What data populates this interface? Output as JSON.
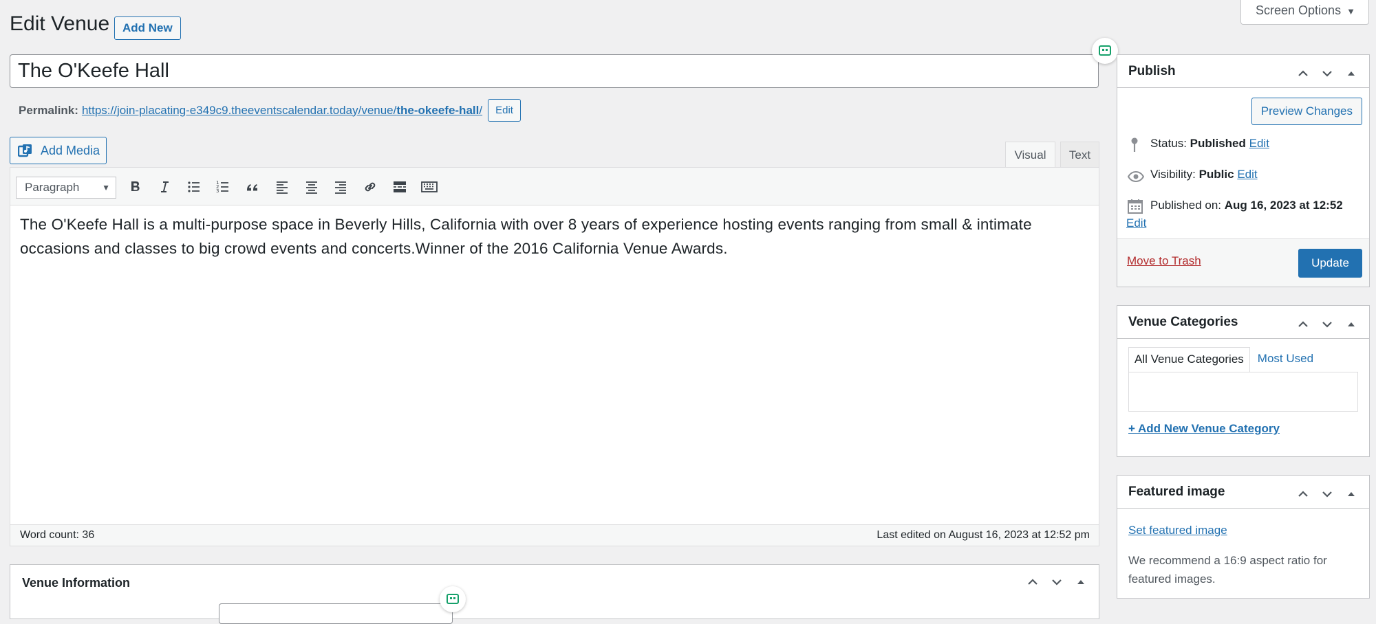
{
  "header": {
    "title": "Edit Venue",
    "add_new_label": "Add New",
    "screen_options_label": "Screen Options"
  },
  "post": {
    "title": "The O'Keefe Hall",
    "permalink_label": "Permalink:",
    "permalink_base": "https://join-placating-e349c9.theeventscalendar.today/venue/",
    "permalink_slug": "the-okeefe-hall",
    "permalink_trailing": "/",
    "permalink_edit_label": "Edit"
  },
  "editor": {
    "add_media_label": "Add Media",
    "tabs": {
      "visual": "Visual",
      "text": "Text"
    },
    "format_select_value": "Paragraph",
    "content": "The O'Keefe Hall is a multi-purpose space in Beverly Hills, California with over 8 years of experience hosting events ranging from small & intimate occasions and classes to big crowd events and concerts.Winner of the 2016 California Venue Awards.",
    "word_count": "Word count: 36",
    "last_edited": "Last edited on August 16, 2023 at 12:52 pm",
    "toolbar_icons": [
      "bold-icon",
      "italic-icon",
      "bullet-list-icon",
      "numbered-list-icon",
      "blockquote-icon",
      "align-left-icon",
      "align-center-icon",
      "align-right-icon",
      "link-icon",
      "read-more-icon",
      "toolbar-toggle-icon"
    ]
  },
  "venue_info": {
    "title": "Venue Information"
  },
  "publish": {
    "title": "Publish",
    "preview_label": "Preview Changes",
    "status_label": "Status:",
    "status_value": "Published",
    "visibility_label": "Visibility:",
    "visibility_value": "Public",
    "published_on_label": "Published on:",
    "published_on_value": "Aug 16, 2023 at 12:52",
    "edit_label": "Edit",
    "trash_label": "Move to Trash",
    "update_label": "Update"
  },
  "categories": {
    "title": "Venue Categories",
    "tab_all": "All Venue Categories",
    "tab_used": "Most Used",
    "add_new_label": "+ Add New Venue Category"
  },
  "featured_image": {
    "title": "Featured image",
    "set_label": "Set featured image",
    "note": "We recommend a 16:9 aspect ratio for featured images."
  },
  "colors": {
    "accent": "#2271b1",
    "danger": "#b32d2e",
    "background": "#f0f0f1",
    "grammarly": "#15a06a"
  }
}
